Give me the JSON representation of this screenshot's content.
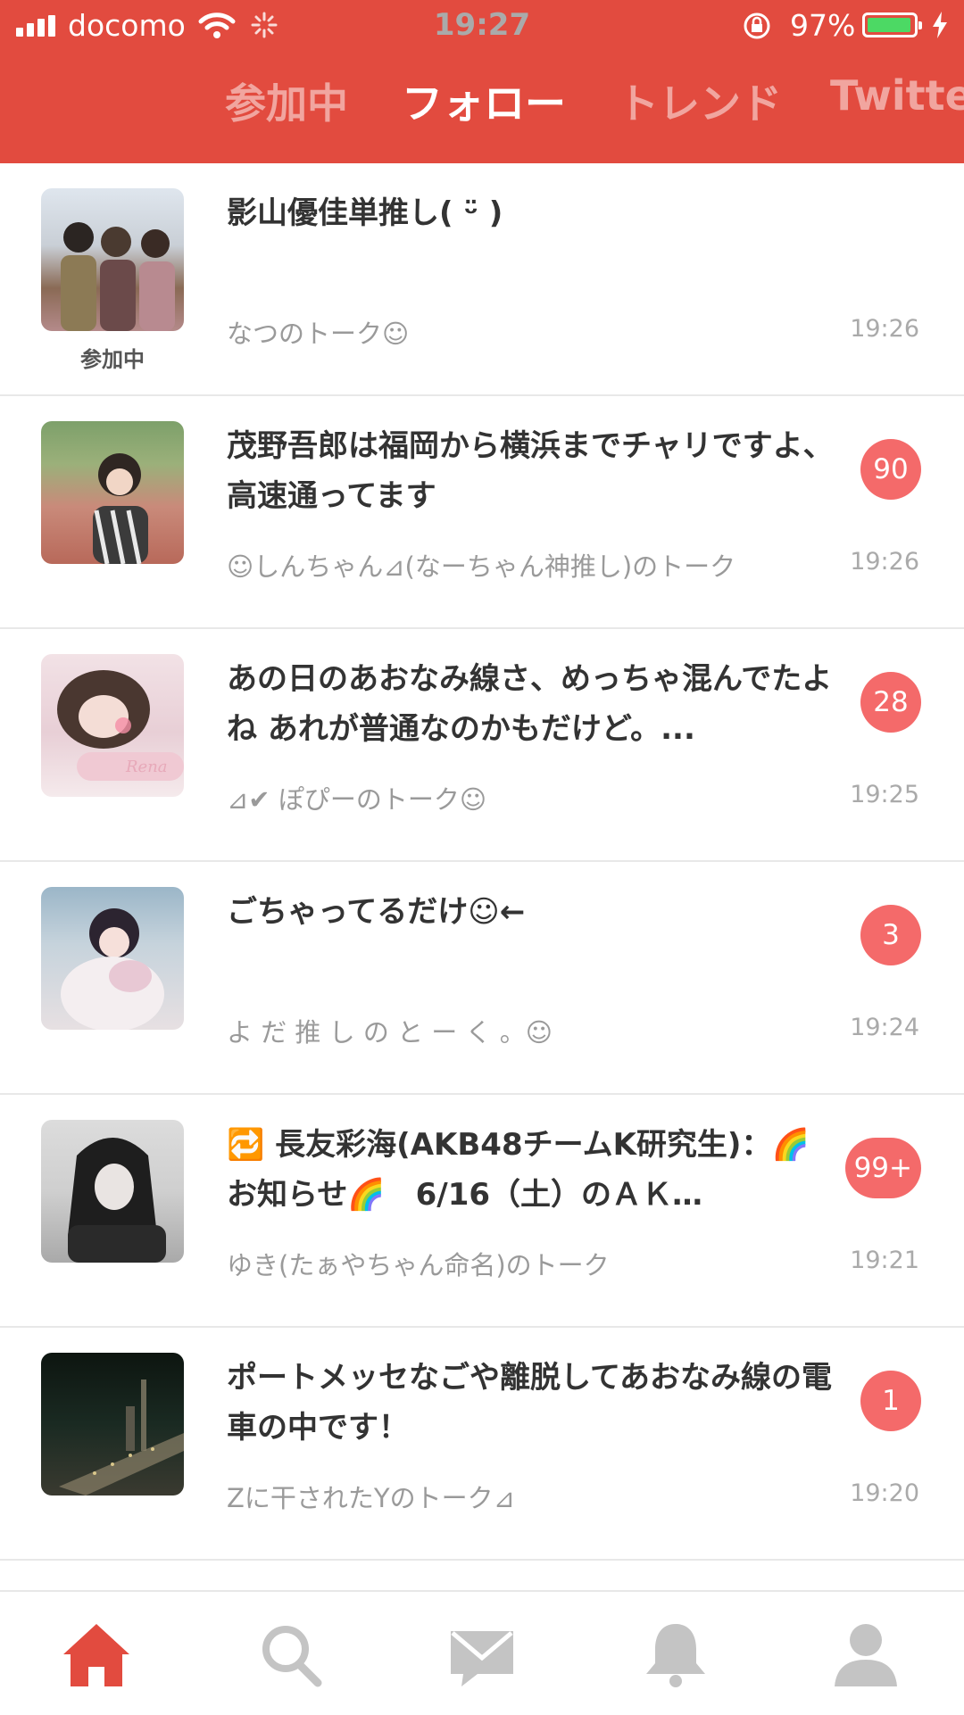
{
  "status_bar": {
    "carrier": "docomo",
    "time": "19:27",
    "battery_percent": "97%",
    "battery_level": 0.97
  },
  "tabs": [
    {
      "label": "参加中",
      "active": false
    },
    {
      "label": "フォロー",
      "active": true
    },
    {
      "label": "トレンド",
      "active": false
    },
    {
      "label": "Twitte",
      "active": false
    }
  ],
  "talks": [
    {
      "title": "影山優佳単推し( ᵕ̈ )",
      "subtitle": "なつのトーク☺",
      "time": "19:26",
      "badge": "",
      "avatar_label": "参加中"
    },
    {
      "title": "茂野吾郎は福岡から横浜までチャリですよ、高速通ってます",
      "subtitle": "☺しんちゃん⊿(なーちゃん神推し)のトーク",
      "time": "19:26",
      "badge": "90",
      "avatar_label": ""
    },
    {
      "title": "あの日のあおなみ線さ、めっちゃ混んでたよね あれが普通なのかもだけど。...",
      "subtitle": "⊿✔ ぽぴーのトーク☺",
      "time": "19:25",
      "badge": "28",
      "avatar_label": ""
    },
    {
      "title": "ごちゃってるだけ☺←",
      "subtitle": "よ だ 推 し の と ー く 。☺",
      "time": "19:24",
      "badge": "3",
      "avatar_label": ""
    },
    {
      "title": "🔁 長友彩海(AKB48チームK研究生)：🌈お知らせ🌈　6/16（土）のＡＫ…",
      "subtitle": "ゆき(たぁやちゃん命名)のトーク",
      "time": "19:21",
      "badge": "99+",
      "avatar_label": ""
    },
    {
      "title": "ポートメッセなごや離脱してあおなみ線の電車の中です！",
      "subtitle": "Zに干されたYのトーク⊿",
      "time": "19:20",
      "badge": "1",
      "avatar_label": ""
    }
  ],
  "bottom_nav": [
    {
      "icon": "home-icon",
      "active": true
    },
    {
      "icon": "search-icon",
      "active": false
    },
    {
      "icon": "mail-icon",
      "active": false
    },
    {
      "icon": "bell-icon",
      "active": false
    },
    {
      "icon": "profile-icon",
      "active": false
    }
  ],
  "colors": {
    "accent": "#e24b3f",
    "badge": "#f46a6a",
    "inactive_icon": "#c4c4c4"
  }
}
